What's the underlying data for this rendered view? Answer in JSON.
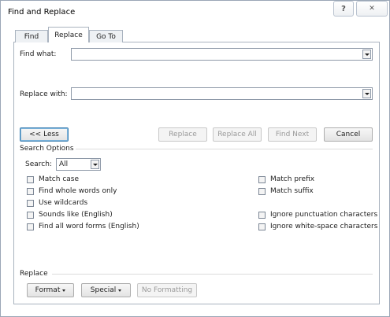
{
  "window": {
    "title": "Find and Replace",
    "help_glyph": "?",
    "close_glyph": "✕"
  },
  "tabs": [
    {
      "label": "Find",
      "active": false
    },
    {
      "label": "Replace",
      "active": true
    },
    {
      "label": "Go To",
      "active": false
    }
  ],
  "find": {
    "label": "Find what:",
    "value": ""
  },
  "replace": {
    "label": "Replace with:",
    "value": ""
  },
  "buttons": {
    "less": "<< Less",
    "replace": "Replace",
    "replace_all": "Replace All",
    "find_next": "Find Next",
    "cancel": "Cancel"
  },
  "search_options": {
    "heading": "Search Options",
    "search_label": "Search:",
    "search_value": "All",
    "left": [
      "Match case",
      "Find whole words only",
      "Use wildcards",
      "Sounds like (English)",
      "Find all word forms (English)"
    ],
    "right": [
      "Match prefix",
      "Match suffix",
      "Ignore punctuation characters",
      "Ignore white-space characters"
    ]
  },
  "replace_section": {
    "heading": "Replace",
    "format": "Format",
    "special": "Special",
    "no_formatting": "No Formatting"
  },
  "colors": {
    "border": "#a9b3bf",
    "focus": "#3c7fb1"
  }
}
